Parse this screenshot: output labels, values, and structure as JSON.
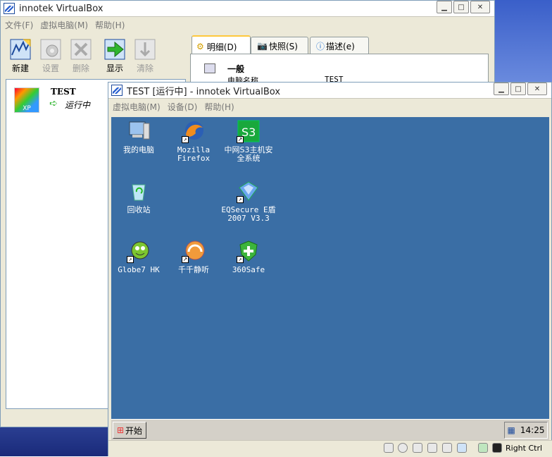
{
  "main_window": {
    "title": "innotek VirtualBox",
    "menu": [
      "文件(F)",
      "虚拟电脑(M)",
      "帮助(H)"
    ],
    "toolbar": [
      {
        "label": "新建",
        "icon": "new-vm-icon"
      },
      {
        "label": "设置",
        "icon": "settings-gear-icon"
      },
      {
        "label": "删除",
        "icon": "delete-icon"
      },
      {
        "label": "显示",
        "icon": "show-arrow-icon"
      },
      {
        "label": "清除",
        "icon": "discard-icon"
      }
    ],
    "vm_list": [
      {
        "name": "TEST",
        "state": "运行中",
        "os_badge": "XP"
      }
    ],
    "tabs": [
      {
        "label": "明细(D)",
        "icon": "gear-icon"
      },
      {
        "label": "快照(S)",
        "icon": "camera-icon"
      },
      {
        "label": "描述(e)",
        "icon": "info-bubble-icon"
      }
    ],
    "details": {
      "section": "一般",
      "row_label": "电脑名称",
      "row_value": "TEST"
    }
  },
  "guest_window": {
    "title": "TEST [运行中] - innotek VirtualBox",
    "menu": [
      "虚拟电脑(M)",
      "设备(D)",
      "帮助(H)"
    ],
    "desktop_icons": [
      {
        "label": "我的电脑",
        "icon": "my-computer-icon"
      },
      {
        "label": "Mozilla\nFirefox",
        "icon": "firefox-icon"
      },
      {
        "label": "中网S3主机安\n全系统",
        "icon": "s3-security-icon"
      },
      {
        "label": "回收站",
        "icon": "recycle-bin-icon"
      },
      {
        "label": "EQSecure E盾\n2007 V3.3",
        "icon": "eqsecure-icon"
      },
      {
        "label": "Globe7 HK",
        "icon": "globe7-icon"
      },
      {
        "label": "千千静听",
        "icon": "ttplayer-icon"
      },
      {
        "label": "360Safe",
        "icon": "360safe-icon"
      }
    ],
    "taskbar": {
      "start_label": "开始",
      "clock": "14:25"
    },
    "status": {
      "host_key": "Right Ctrl"
    }
  },
  "colors": {
    "guest_desktop": "#3a6ea5",
    "window_face": "#ece9d8"
  }
}
